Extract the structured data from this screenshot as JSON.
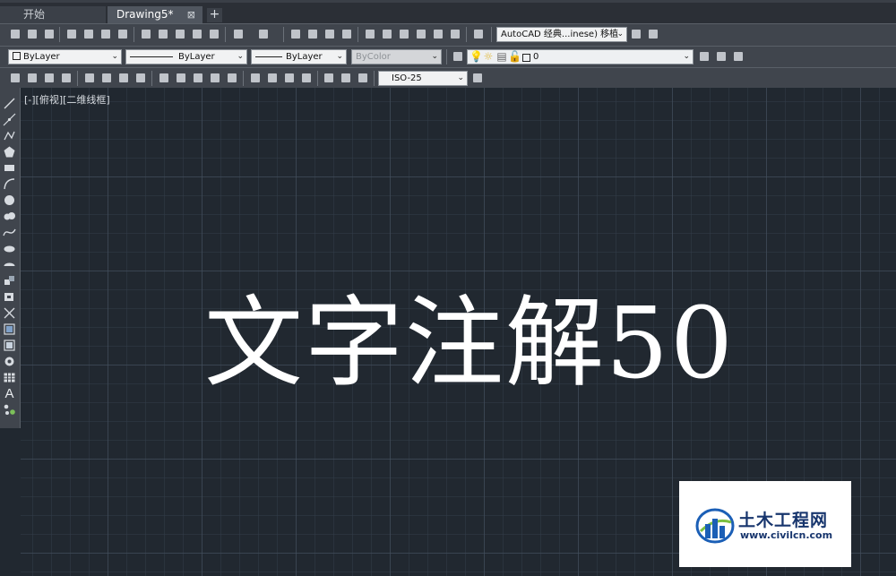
{
  "tabs": {
    "start_label": "开始",
    "drawing_label": "Drawing5*",
    "close_glyph": "⊠",
    "add_glyph": "+"
  },
  "toolbar1": {
    "workspace_value": "AutoCAD 经典...inese) 移植"
  },
  "properties_bar": {
    "color_value": "ByLayer",
    "linetype_value": "ByLayer",
    "lineweight_value": "ByLayer",
    "plotstyle_value": "ByColor",
    "layer_value": "0"
  },
  "dimension_bar": {
    "dimstyle_value": "ISO-25"
  },
  "viewport": {
    "label": "[-][俯视][二维线框]"
  },
  "drawing": {
    "text": "文字注解50"
  },
  "watermark": {
    "name": "土木工程网",
    "url": "www.civilcn.com"
  },
  "colors": {
    "canvas_bg": "#212830",
    "toolbar_bg": "#40454d",
    "watermark_text": "#17356d"
  },
  "icons": {
    "left_tools": [
      "line-icon",
      "construction-line-icon",
      "polyline-icon",
      "polygon-icon",
      "rectangle-icon",
      "arc-icon",
      "circle-icon",
      "revcloud-icon",
      "spline-icon",
      "ellipse-icon",
      "ellipse-arc-icon",
      "insert-block-icon",
      "make-block-icon",
      "point-icon",
      "hatch-icon",
      "gradient-icon",
      "region-icon",
      "table-icon",
      "multiline-text-icon",
      "add-selected-icon"
    ]
  }
}
